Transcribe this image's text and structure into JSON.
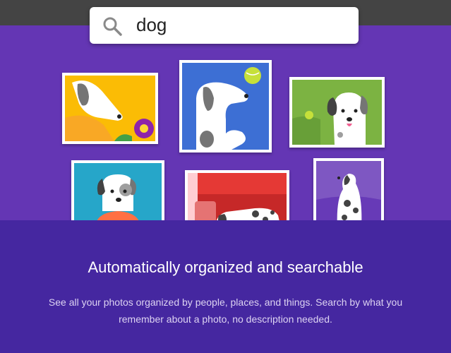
{
  "colors": {
    "hero_background": "#6436b4",
    "panel_background": "#4527a0",
    "topbar": "#444444"
  },
  "search": {
    "icon": "search-icon",
    "query": "dog"
  },
  "photos": [
    {
      "name": "dog-yellow-flower",
      "background": "#fbbc05"
    },
    {
      "name": "dog-blue-tennis-ball",
      "background": "#3d6fd4"
    },
    {
      "name": "dog-green-grass",
      "background": "#7cb342"
    },
    {
      "name": "dog-teal-orange-shirt",
      "background": "#26a6c9"
    },
    {
      "name": "dog-red-couch",
      "background": "#e53935"
    },
    {
      "name": "dog-purple-sitting",
      "background": "#7e57c2"
    }
  ],
  "feature": {
    "title": "Automatically organized and searchable",
    "description_line1": "See all your photos organized by people, places, and things. Search by what you",
    "description_line2": "remember about a photo, no description needed."
  }
}
